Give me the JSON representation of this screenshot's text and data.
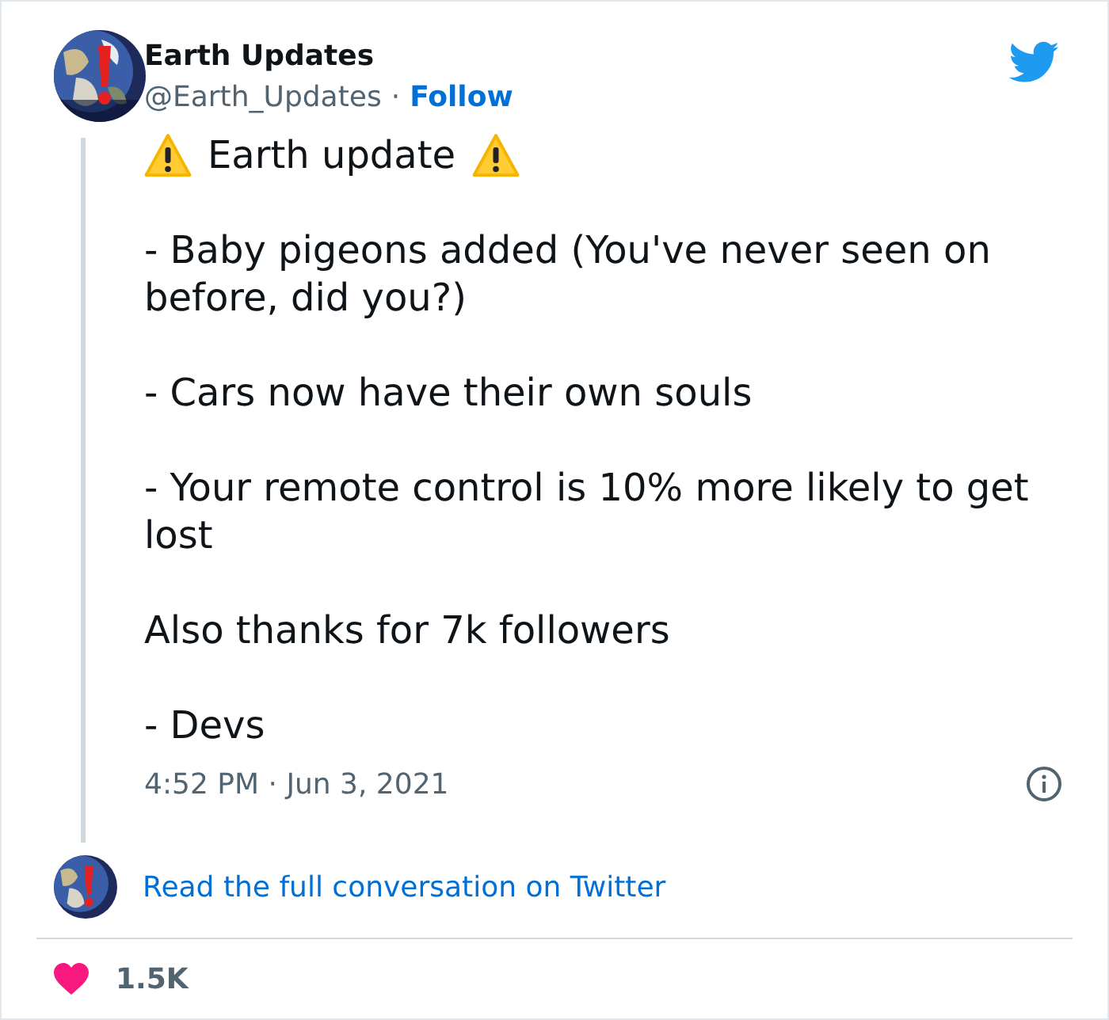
{
  "author": {
    "name": "Earth Updates",
    "handle": "@Earth_Updates",
    "separator": "·",
    "follow": "Follow"
  },
  "tweet": {
    "title": "Earth update",
    "paragraphs": [
      "- Baby pigeons added (You've never seen on before, did you?)",
      "- Cars now have their own souls",
      "- Your remote control is 10% more likely to get lost",
      "Also thanks for 7k followers",
      "- Devs"
    ],
    "timestamp": "4:52 PM · Jun 3, 2021"
  },
  "conversation_link": "Read the full conversation on Twitter",
  "likes": {
    "count": "1.5K"
  }
}
